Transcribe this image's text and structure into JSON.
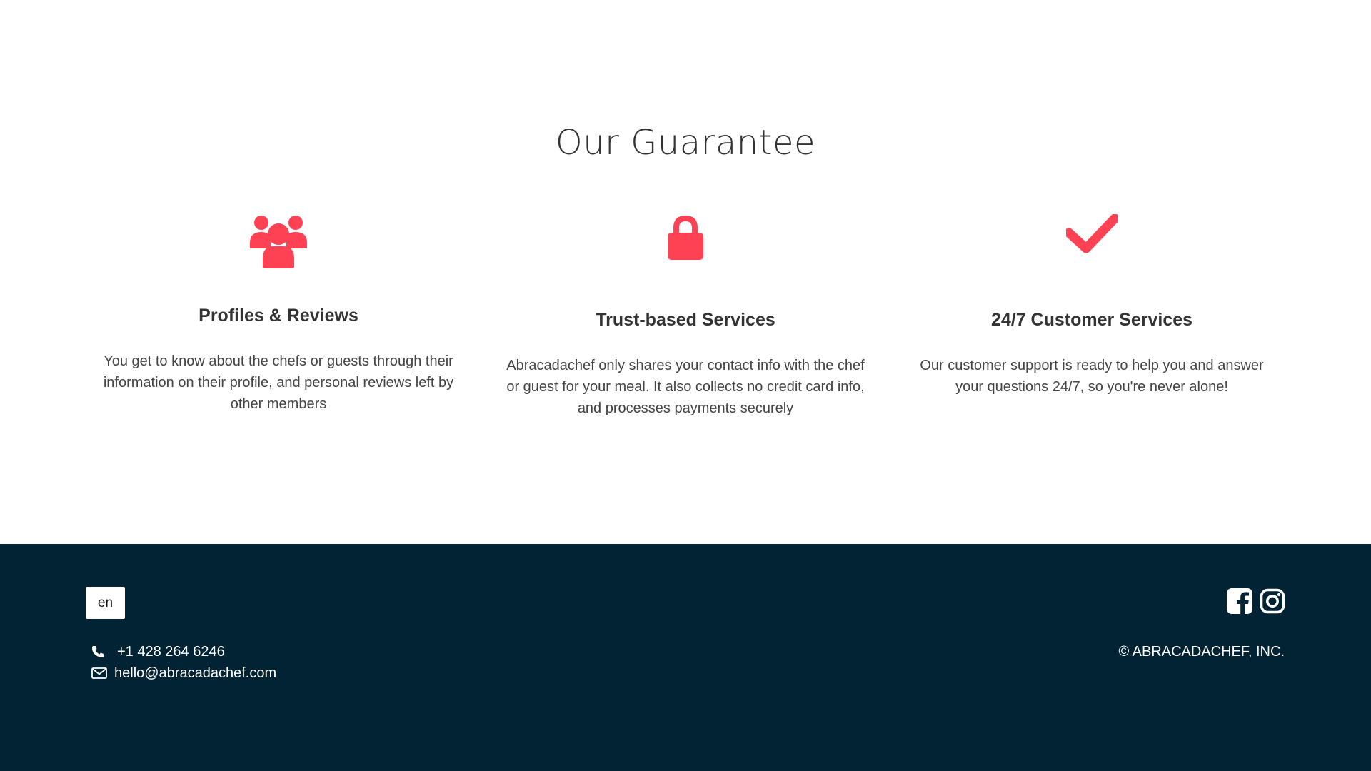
{
  "guarantee": {
    "title": "Our Guarantee",
    "accent_color": "#ff4154",
    "features": [
      {
        "icon": "users-icon",
        "title": "Profiles & Reviews",
        "text": "You get to know about the chefs or guests through their information on their profile, and personal reviews left by other members"
      },
      {
        "icon": "lock-icon",
        "title": "Trust-based Services",
        "text": "Abracadachef only shares your contact info with the chef or guest for your meal. It also collects no credit card info, and processes payments securely"
      },
      {
        "icon": "check-icon",
        "title": "24/7 Customer Services",
        "text": "Our customer support is ready to help you and answer your questions 24/7, so you're never alone!"
      }
    ]
  },
  "footer": {
    "background_color": "#022333",
    "language": "en",
    "phone": "+1 428 264 6246",
    "email": "hello@abracadachef.com",
    "social": [
      "facebook-icon",
      "instagram-icon"
    ],
    "copyright": "© ABRACADACHEF, INC."
  }
}
